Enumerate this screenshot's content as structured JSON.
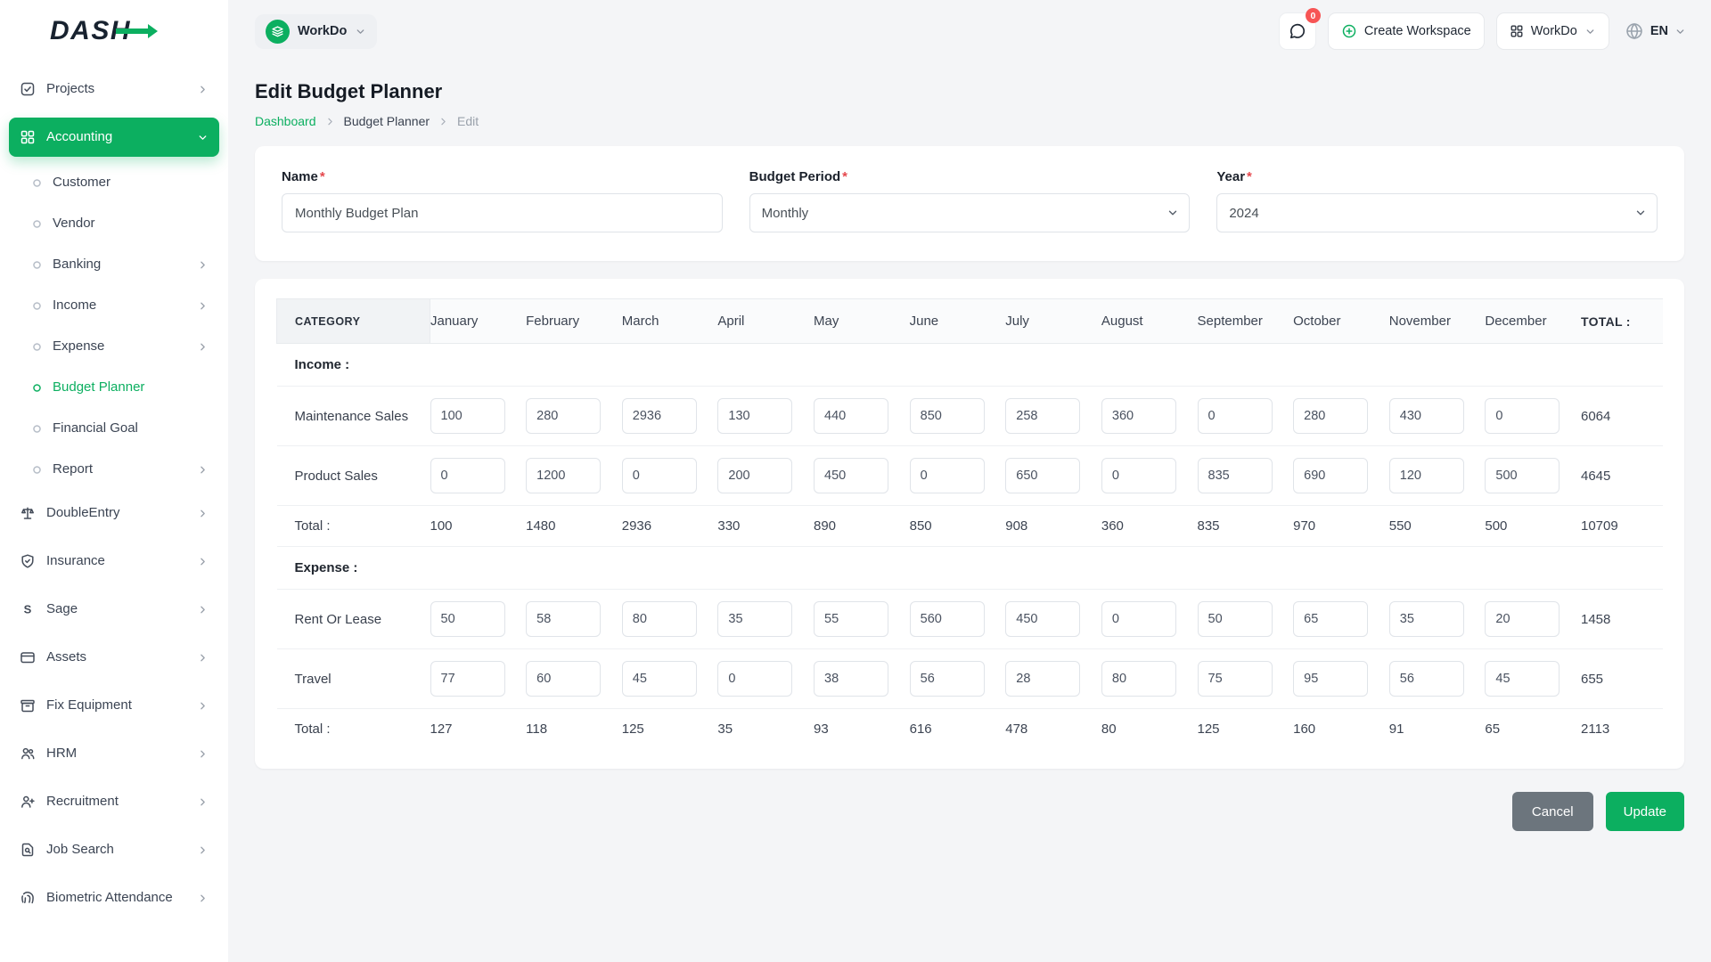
{
  "colors": {
    "primary": "#0CAF60",
    "badge": "#f75555",
    "cancel": "#6c757d"
  },
  "header": {
    "logo_text": "DASH",
    "workspace_switcher": {
      "label": "WorkDo",
      "icon": "layers-icon"
    },
    "messages_badge": "0",
    "create_workspace_label": "Create Workspace",
    "app_menu_label": "WorkDo",
    "language": "EN"
  },
  "sidebar": {
    "items": [
      {
        "id": "projects",
        "label": "Projects",
        "icon": "projects-icon",
        "chevron": "right"
      },
      {
        "id": "accounting",
        "label": "Accounting",
        "icon": "accounting-icon",
        "chevron": "down",
        "active": true
      },
      {
        "id": "customer",
        "label": "Customer",
        "child": true
      },
      {
        "id": "vendor",
        "label": "Vendor",
        "child": true
      },
      {
        "id": "banking",
        "label": "Banking",
        "child": true,
        "chevron": "right"
      },
      {
        "id": "income",
        "label": "Income",
        "child": true,
        "chevron": "right"
      },
      {
        "id": "expense",
        "label": "Expense",
        "child": true,
        "chevron": "right"
      },
      {
        "id": "budget-planner",
        "label": "Budget Planner",
        "child": true,
        "active_child": true
      },
      {
        "id": "financial-goal",
        "label": "Financial Goal",
        "child": true
      },
      {
        "id": "report",
        "label": "Report",
        "child": true,
        "chevron": "right"
      },
      {
        "id": "double-entry",
        "label": "DoubleEntry",
        "icon": "scale-icon",
        "chevron": "right"
      },
      {
        "id": "insurance",
        "label": "Insurance",
        "icon": "shield-icon",
        "chevron": "right"
      },
      {
        "id": "sage",
        "label": "Sage",
        "icon": "sage-icon",
        "chevron": "right"
      },
      {
        "id": "assets",
        "label": "Assets",
        "icon": "card-icon",
        "chevron": "right"
      },
      {
        "id": "fix-equipment",
        "label": "Fix Equipment",
        "icon": "box-icon",
        "chevron": "right"
      },
      {
        "id": "hrm",
        "label": "HRM",
        "icon": "people-icon",
        "chevron": "right"
      },
      {
        "id": "recruitment",
        "label": "Recruitment",
        "icon": "person-plus-icon",
        "chevron": "right"
      },
      {
        "id": "job-search",
        "label": "Job Search",
        "icon": "doc-search-icon",
        "chevron": "right"
      },
      {
        "id": "biometric-attendance",
        "label": "Biometric Attendance",
        "icon": "fingerprint-icon",
        "chevron": "right"
      }
    ]
  },
  "page": {
    "title": "Edit Budget Planner",
    "breadcrumb": [
      {
        "label": "Dashboard"
      },
      {
        "label": "Budget Planner"
      },
      {
        "label": "Edit"
      }
    ]
  },
  "form": {
    "required_mark": "*",
    "name": {
      "label": "Name",
      "value": "Monthly Budget Plan"
    },
    "period": {
      "label": "Budget Period",
      "value": "Monthly"
    },
    "year": {
      "label": "Year",
      "value": "2024"
    }
  },
  "table": {
    "category_header": "CATEGORY",
    "total_header": "TOTAL :",
    "months": [
      "January",
      "February",
      "March",
      "April",
      "May",
      "June",
      "July",
      "August",
      "September",
      "October",
      "November",
      "December"
    ],
    "sections": [
      {
        "title": "Income :",
        "rows": [
          {
            "label": "Maintenance Sales",
            "values": [
              "100",
              "280",
              "2936",
              "130",
              "440",
              "850",
              "258",
              "360",
              "0",
              "280",
              "430",
              "0"
            ],
            "total": "6064"
          },
          {
            "label": "Product Sales",
            "values": [
              "0",
              "1200",
              "0",
              "200",
              "450",
              "0",
              "650",
              "0",
              "835",
              "690",
              "120",
              "500"
            ],
            "total": "4645"
          }
        ],
        "total_label": "Total :",
        "totals": [
          "100",
          "1480",
          "2936",
          "330",
          "890",
          "850",
          "908",
          "360",
          "835",
          "970",
          "550",
          "500"
        ],
        "grand_total": "10709"
      },
      {
        "title": "Expense :",
        "rows": [
          {
            "label": "Rent Or Lease",
            "values": [
              "50",
              "58",
              "80",
              "35",
              "55",
              "560",
              "450",
              "0",
              "50",
              "65",
              "35",
              "20"
            ],
            "total": "1458"
          },
          {
            "label": "Travel",
            "values": [
              "77",
              "60",
              "45",
              "0",
              "38",
              "56",
              "28",
              "80",
              "75",
              "95",
              "56",
              "45"
            ],
            "total": "655"
          }
        ],
        "total_label": "Total :",
        "totals": [
          "127",
          "118",
          "125",
          "35",
          "93",
          "616",
          "478",
          "80",
          "125",
          "160",
          "91",
          "65"
        ],
        "grand_total": "2113"
      }
    ]
  },
  "actions": {
    "cancel_label": "Cancel",
    "update_label": "Update"
  }
}
